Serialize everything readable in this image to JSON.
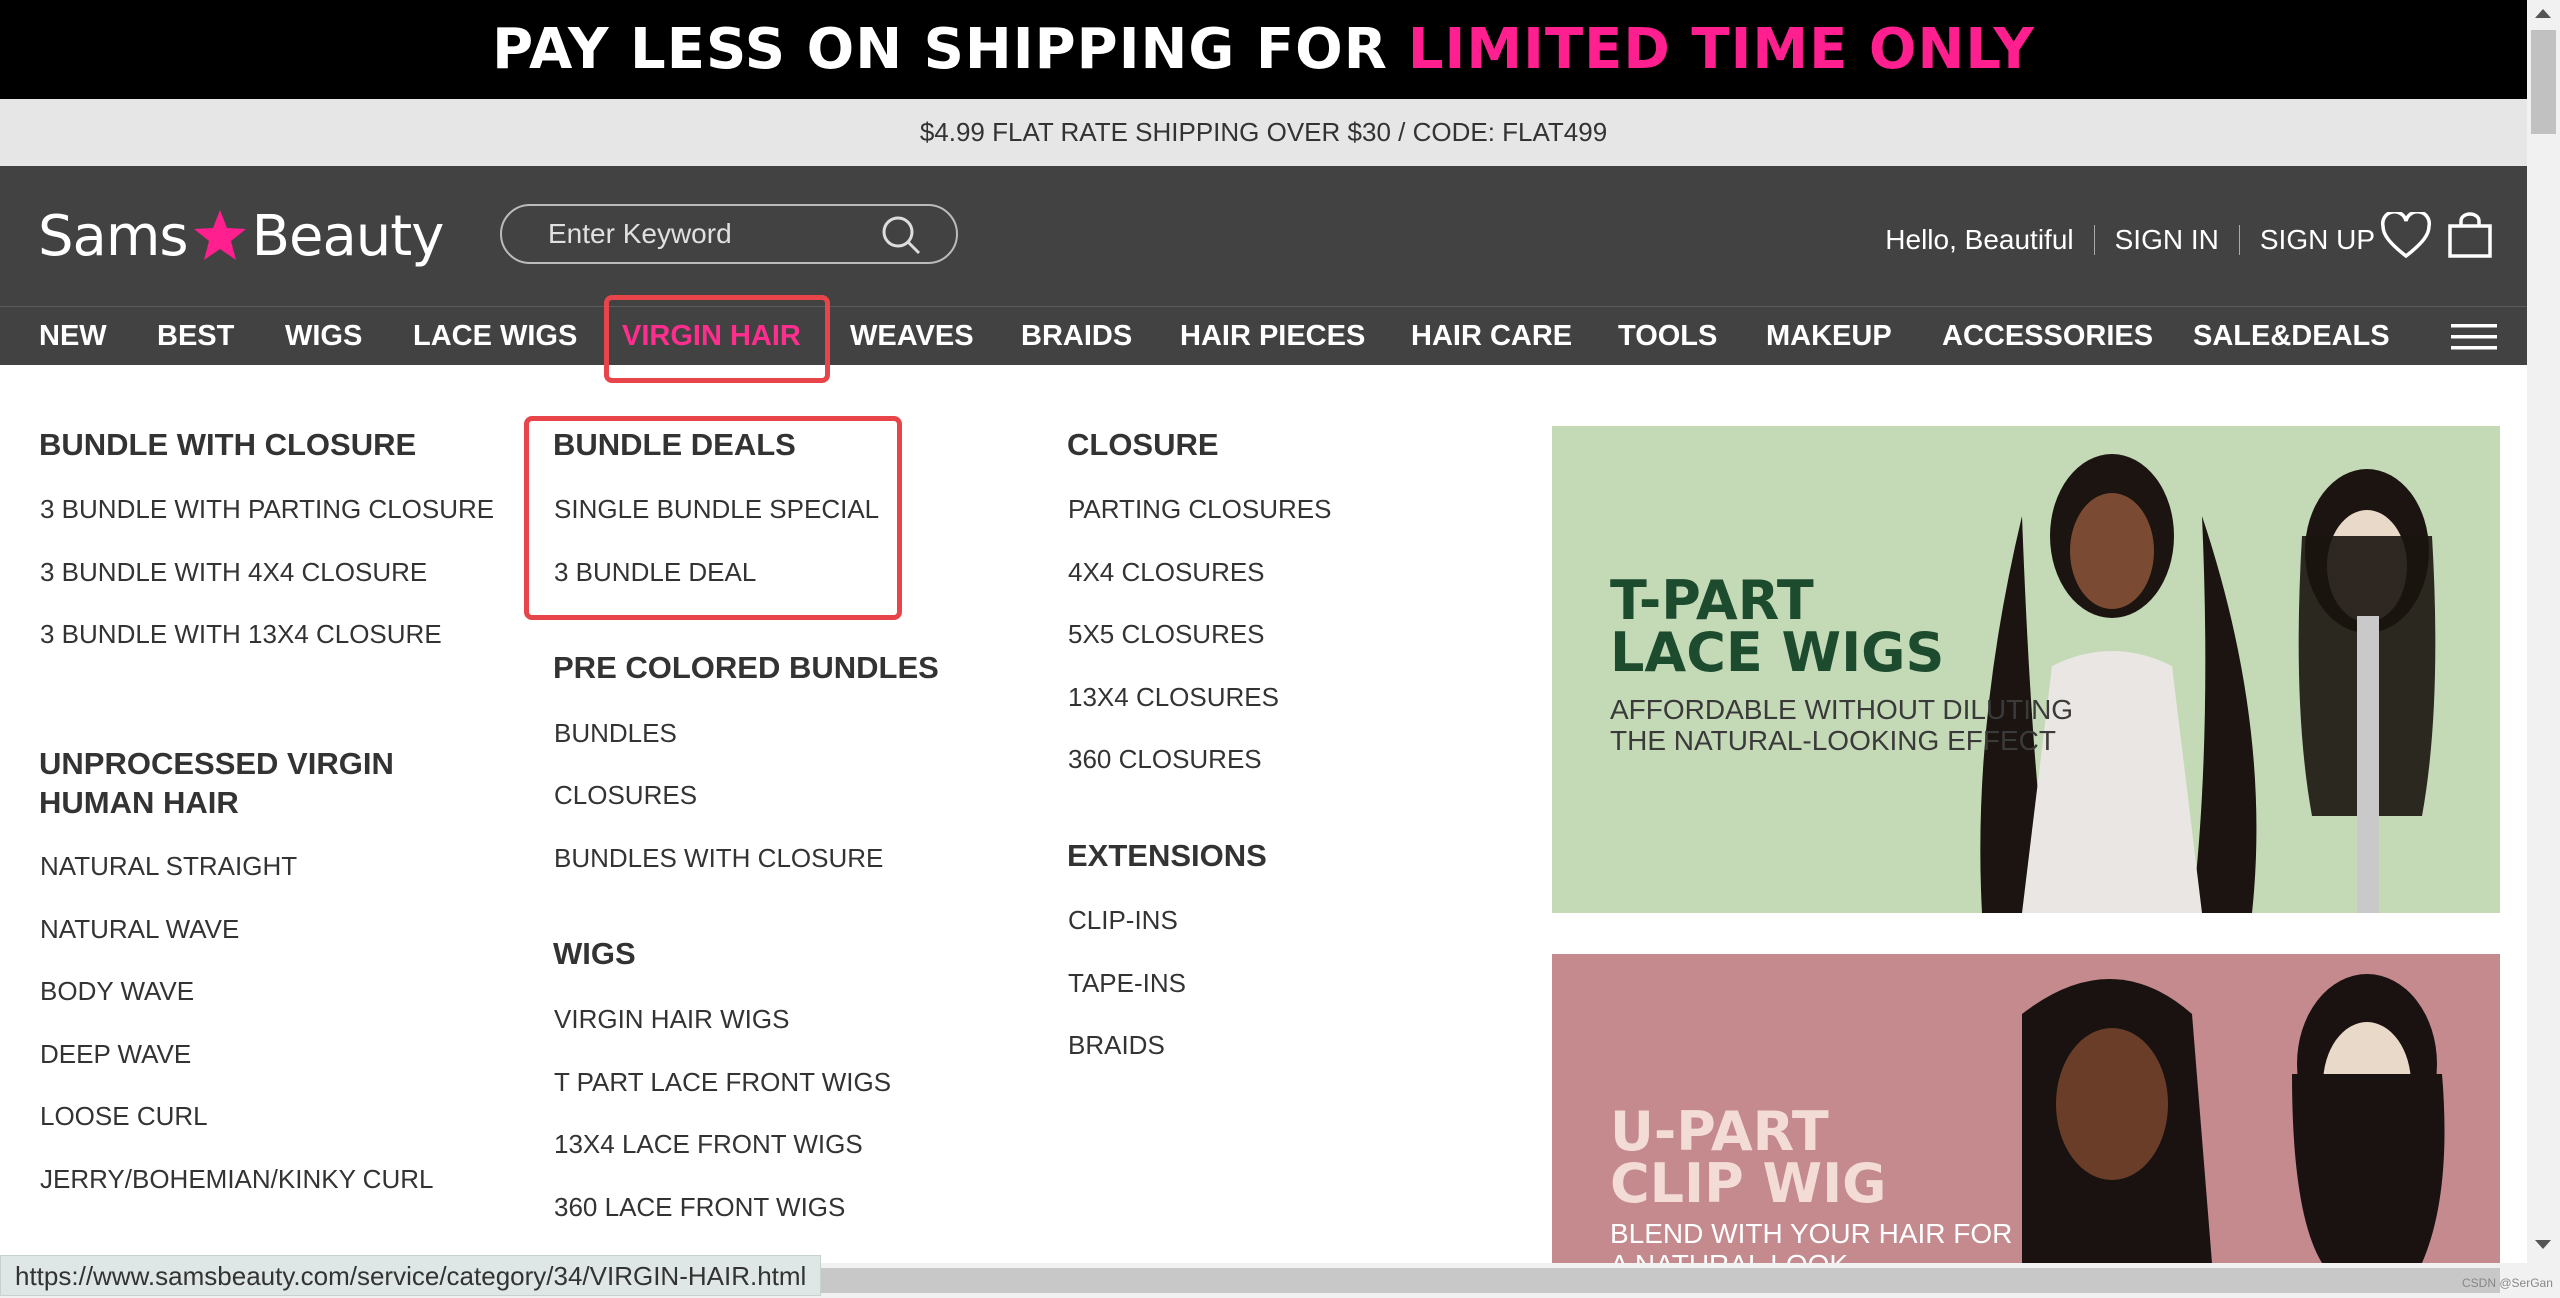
{
  "promo": {
    "text_white": "PAY LESS ON SHIPPING FOR",
    "text_pink": "LIMITED TIME ONLY"
  },
  "shipping": "$4.99 FLAT RATE SHIPPING OVER $30 / CODE: FLAT499",
  "header": {
    "logo_left": "Sams",
    "logo_right": "Beauty",
    "search_placeholder": "Enter Keyword",
    "greeting": "Hello, Beautiful",
    "sign_in": "SIGN IN",
    "sign_up": "SIGN UP",
    "icons": [
      "heart-icon",
      "bag-icon",
      "search-icon",
      "menu-icon"
    ]
  },
  "nav": {
    "items": [
      "NEW",
      "BEST",
      "WIGS",
      "LACE WIGS",
      "VIRGIN HAIR",
      "WEAVES",
      "BRAIDS",
      "HAIR PIECES",
      "HAIR CARE",
      "TOOLS",
      "MAKEUP",
      "ACCESSORIES",
      "SALE&DEALS"
    ],
    "active": "VIRGIN HAIR"
  },
  "menu": {
    "col1": {
      "h1": "BUNDLE WITH CLOSURE",
      "l1": [
        "3 BUNDLE WITH PARTING CLOSURE",
        "3 BUNDLE WITH 4X4 CLOSURE",
        "3 BUNDLE WITH 13X4 CLOSURE"
      ],
      "h2a": "UNPROCESSED VIRGIN",
      "h2b": "HUMAN HAIR",
      "l2": [
        "NATURAL STRAIGHT",
        "NATURAL WAVE",
        "BODY WAVE",
        "DEEP WAVE",
        "LOOSE CURL",
        "JERRY/BOHEMIAN/KINKY CURL"
      ]
    },
    "col2": {
      "h1": "BUNDLE DEALS",
      "l1": [
        "SINGLE BUNDLE SPECIAL",
        "3 BUNDLE DEAL"
      ],
      "h2": "PRE COLORED BUNDLES",
      "l2": [
        "BUNDLES",
        "CLOSURES",
        "BUNDLES WITH CLOSURE"
      ],
      "h3": "WIGS",
      "l3": [
        "VIRGIN HAIR WIGS",
        "T PART LACE FRONT WIGS",
        "13X4 LACE FRONT WIGS",
        "360 LACE FRONT WIGS"
      ]
    },
    "col3": {
      "h1": "CLOSURE",
      "l1": [
        "PARTING CLOSURES",
        "4X4 CLOSURES",
        "5X5 CLOSURES",
        "13X4 CLOSURES",
        "360 CLOSURES"
      ],
      "h2": "EXTENSIONS",
      "l2": [
        "CLIP-INS",
        "TAPE-INS",
        "BRAIDS"
      ]
    }
  },
  "banners": {
    "b1": {
      "t1": "T-PART",
      "t2": "LACE WIGS",
      "s1": "AFFORDABLE WITHOUT DILUTING",
      "s2": "THE NATURAL-LOOKING EFFECT"
    },
    "b2": {
      "t1": "U-PART",
      "t2": "CLIP WIG",
      "s1": "BLEND WITH YOUR HAIR FOR",
      "s2": "A NATURAL LOOK"
    }
  },
  "status_url": "https://www.samsbeauty.com/service/category/34/VIRGIN-HAIR.html",
  "watermark": "CSDN @SerGan",
  "colors": {
    "accent": "#ff2e8e",
    "header_bg": "#424242",
    "highlight_box": "#e8454a",
    "banner1_bg": "#c4dab7",
    "banner2_bg": "#c48a8e"
  }
}
